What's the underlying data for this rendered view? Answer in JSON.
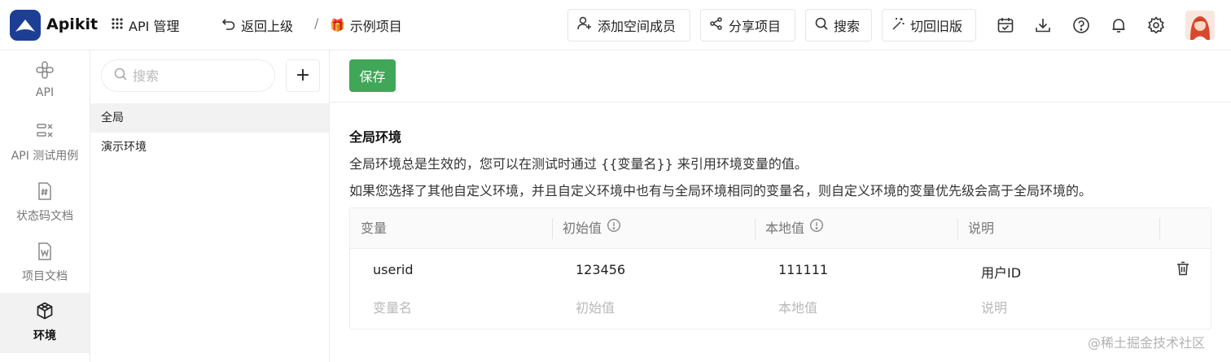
{
  "app": {
    "name": "Apikit"
  },
  "topbar": {
    "api_manage": "API 管理",
    "back": "返回上级",
    "separator": "/",
    "project_icon": "🎁",
    "project_name": "示例项目",
    "buttons": {
      "add_member": "添加空间成员",
      "share": "分享项目",
      "search": "搜索",
      "old_version": "切回旧版"
    },
    "icons": [
      "calendar-check-icon",
      "download-icon",
      "help-icon",
      "bell-icon",
      "gear-icon",
      "avatar"
    ]
  },
  "left_rail": {
    "items": [
      {
        "label": "API",
        "icon": "api-icon"
      },
      {
        "label": "API 测试用例",
        "icon": "test-case-icon"
      },
      {
        "label": "状态码文档",
        "icon": "status-code-doc-icon"
      },
      {
        "label": "项目文档",
        "icon": "word-doc-icon"
      },
      {
        "label": "环境",
        "icon": "cube-icon",
        "active": true
      }
    ]
  },
  "env_panel": {
    "search_placeholder": "搜索",
    "add_label": "+",
    "items": [
      {
        "label": "全局",
        "active": true
      },
      {
        "label": "演示环境"
      }
    ]
  },
  "main": {
    "save_label": "保存",
    "section_title": "全局环境",
    "desc_line1": "全局环境总是生效的，您可以在测试时通过 {{变量名}} 来引用环境变量的值。",
    "desc_line2": "如果您选择了其他自定义环境，并且自定义环境中也有与全局环境相同的变量名，则自定义环境的变量优先级会高于全局环境的。",
    "table": {
      "headers": [
        "变量",
        "初始值",
        "本地值",
        "说明"
      ],
      "rows": [
        {
          "name": "userid",
          "initial": "123456",
          "local": "111111",
          "desc": "用户ID"
        }
      ],
      "new_row_placeholders": {
        "name": "变量名",
        "initial": "初始值",
        "local": "本地值",
        "desc": "说明"
      }
    }
  },
  "watermark": "@稀土掘金技术社区",
  "colors": {
    "brand": "#1c3f95",
    "save": "#3fa757",
    "active_bg": "#f2f2f2"
  }
}
